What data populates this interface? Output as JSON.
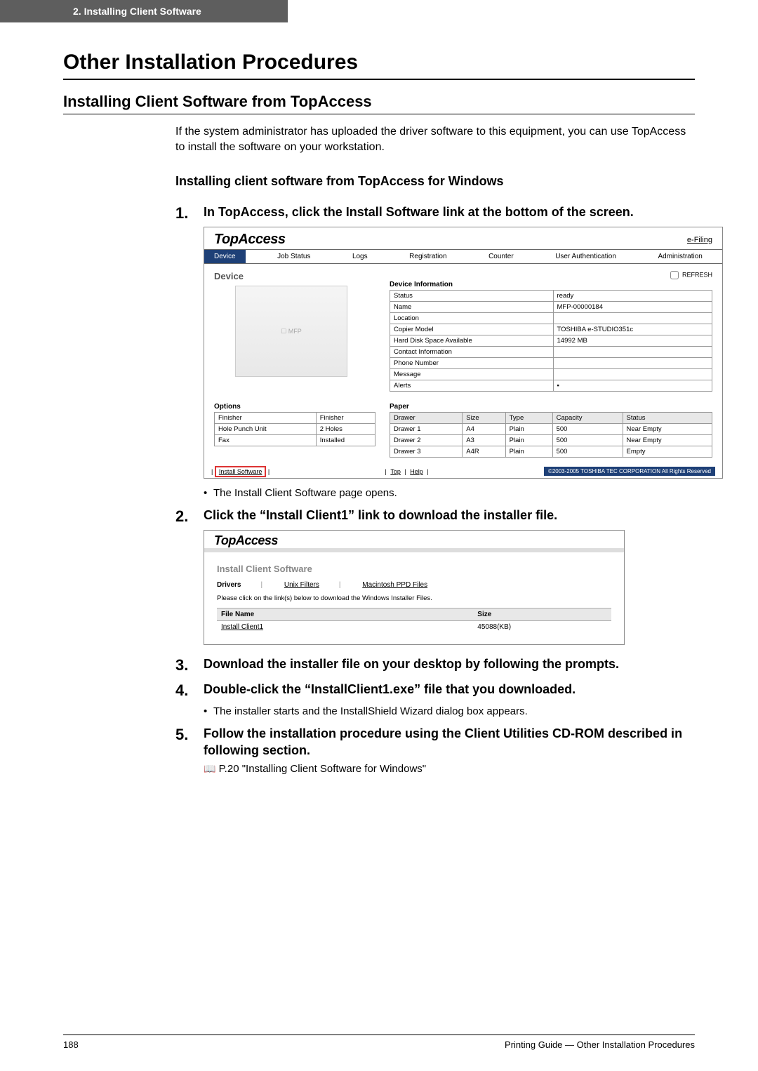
{
  "header_tab": "2. Installing Client Software",
  "h1": "Other Installation Procedures",
  "h2": "Installing Client Software from TopAccess",
  "intro": "If the system administrator has uploaded the driver software to this equipment, you can use TopAccess to install the software on your workstation.",
  "h3": "Installing client software from TopAccess for Windows",
  "steps": {
    "s1": "In TopAccess, click the Install Software link at the bottom of the screen.",
    "s1_sub": "The Install Client Software page opens.",
    "s2": "Click the “Install Client1” link to download the installer file.",
    "s3": "Download the installer file on your desktop by following the prompts.",
    "s4": "Double-click the “InstallClient1.exe” file that you downloaded.",
    "s4_sub": "The installer starts and the InstallShield Wizard dialog box appears.",
    "s5": "Follow the installation procedure using the Client Utilities CD-ROM described in following section.",
    "s5_ref": "P.20 \"Installing Client Software for Windows\""
  },
  "screenshot1": {
    "logo": "TopAccess",
    "efiling": "e-Filing",
    "tabs": [
      "Device",
      "Job Status",
      "Logs",
      "Registration",
      "Counter",
      "User Authentication",
      "Administration"
    ],
    "device_label": "Device",
    "refresh": "REFRESH",
    "devinfo_title": "Device Information",
    "devinfo": [
      {
        "k": "Status",
        "v": "ready"
      },
      {
        "k": "Name",
        "v": "MFP-00000184"
      },
      {
        "k": "Location",
        "v": ""
      },
      {
        "k": "Copier Model",
        "v": "TOSHIBA e-STUDIO351c"
      },
      {
        "k": "Hard Disk Space Available",
        "v": "14992 MB"
      },
      {
        "k": "Contact Information",
        "v": ""
      },
      {
        "k": "Phone Number",
        "v": ""
      },
      {
        "k": "Message",
        "v": ""
      },
      {
        "k": "Alerts",
        "v": "▪"
      }
    ],
    "options_title": "Options",
    "options": [
      {
        "k": "Finisher",
        "v": "Finisher"
      },
      {
        "k": "Hole Punch Unit",
        "v": "2 Holes"
      },
      {
        "k": "Fax",
        "v": "Installed"
      }
    ],
    "paper_title": "Paper",
    "paper_headers": [
      "Drawer",
      "Size",
      "Type",
      "Capacity",
      "Status"
    ],
    "paper": [
      [
        "Drawer 1",
        "A4",
        "Plain",
        "500",
        "Near Empty"
      ],
      [
        "Drawer 2",
        "A3",
        "Plain",
        "500",
        "Near Empty"
      ],
      [
        "Drawer 3",
        "A4R",
        "Plain",
        "500",
        "Empty"
      ]
    ],
    "install_link": "Install Software",
    "top_link": "Top",
    "help_link": "Help",
    "copyright": "©2003-2005 TOSHIBA TEC CORPORATION All Rights Reserved"
  },
  "screenshot2": {
    "logo": "TopAccess",
    "title": "Install Client Software",
    "tabs": [
      "Drivers",
      "Unix Filters",
      "Macintosh PPD Files"
    ],
    "note": "Please click on the link(s) below to download the Windows Installer Files.",
    "headers": [
      "File Name",
      "Size"
    ],
    "row": [
      "Install Client1",
      "45088(KB)"
    ]
  },
  "footer": {
    "page": "188",
    "right": "Printing Guide — Other Installation Procedures"
  }
}
